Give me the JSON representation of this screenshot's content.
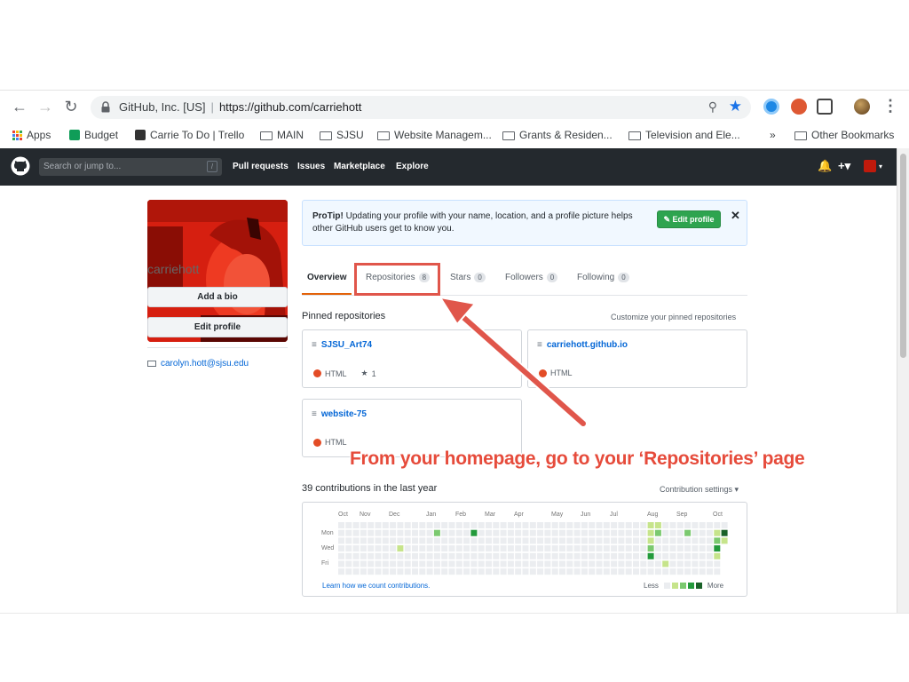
{
  "browser": {
    "site_identity": "GitHub, Inc. [US]",
    "url": "https://github.com/carriehott",
    "bookmarks": [
      "Apps",
      "Budget",
      "Carrie To Do | Trello",
      "MAIN",
      "SJSU",
      "Website Managem...",
      "Grants & Residen...",
      "Television and Ele..."
    ],
    "overflow": "»",
    "other_bookmarks": "Other Bookmarks"
  },
  "github_header": {
    "search_placeholder": "Search or jump to...",
    "search_shortcut": "/",
    "nav": [
      "Pull requests",
      "Issues",
      "Marketplace",
      "Explore"
    ],
    "add_label": "+▾"
  },
  "profile": {
    "username": "carriehott",
    "add_bio": "Add a bio",
    "edit_profile": "Edit profile",
    "email": "carolyn.hott@sjsu.edu"
  },
  "protip": {
    "label": "ProTip!",
    "text": " Updating your profile with your name, location, and a profile picture helps other GitHub users get to know you.",
    "button": "✎ Edit profile",
    "close": "✕"
  },
  "tabs": [
    {
      "label": "Overview",
      "count": ""
    },
    {
      "label": "Repositories",
      "count": "8"
    },
    {
      "label": "Stars",
      "count": "0"
    },
    {
      "label": "Followers",
      "count": "0"
    },
    {
      "label": "Following",
      "count": "0"
    }
  ],
  "pinned": {
    "title": "Pinned repositories",
    "customize": "Customize your pinned repositories",
    "repos": [
      {
        "name": "SJSU_Art74",
        "language": "HTML",
        "stars": "1"
      },
      {
        "name": "carriehott.github.io",
        "language": "HTML",
        "stars": ""
      },
      {
        "name": "website-75",
        "language": "HTML",
        "stars": ""
      }
    ]
  },
  "contributions": {
    "title": "39 contributions in the last year",
    "settings": "Contribution settings ▾",
    "months": [
      "Oct",
      "Nov",
      "Dec",
      "Jan",
      "Feb",
      "Mar",
      "Apr",
      "May",
      "Jun",
      "Jul",
      "Aug",
      "Sep",
      "Oct"
    ],
    "days": [
      "Mon",
      "Wed",
      "Fri"
    ],
    "learn_link": "Learn how we count contributions.",
    "less": "Less",
    "more": "More",
    "levels": [
      "#ebedf0",
      "#c6e48b",
      "#7bc96f",
      "#239a3b",
      "#196127"
    ],
    "active_cells": [
      {
        "week": 13,
        "day": 1,
        "level": 2
      },
      {
        "week": 18,
        "day": 1,
        "level": 3
      },
      {
        "week": 8,
        "day": 3,
        "level": 1
      },
      {
        "week": 42,
        "day": 0,
        "level": 1
      },
      {
        "week": 43,
        "day": 0,
        "level": 1
      },
      {
        "week": 42,
        "day": 1,
        "level": 1
      },
      {
        "week": 43,
        "day": 1,
        "level": 2
      },
      {
        "week": 42,
        "day": 2,
        "level": 1
      },
      {
        "week": 42,
        "day": 3,
        "level": 2
      },
      {
        "week": 42,
        "day": 4,
        "level": 3
      },
      {
        "week": 44,
        "day": 5,
        "level": 1
      },
      {
        "week": 47,
        "day": 1,
        "level": 2
      },
      {
        "week": 51,
        "day": 1,
        "level": 1
      },
      {
        "week": 51,
        "day": 2,
        "level": 2
      },
      {
        "week": 51,
        "day": 3,
        "level": 3
      },
      {
        "week": 51,
        "day": 4,
        "level": 1
      },
      {
        "week": 52,
        "day": 1,
        "level": 4
      },
      {
        "week": 52,
        "day": 2,
        "level": 1
      }
    ]
  },
  "annotation": "From your homepage, go to your ‘Repositories’ page",
  "colors": {
    "annotation": "#e64b3b",
    "gh_header": "#24292e",
    "link": "#0366d6",
    "tab_accent": "#e36209",
    "html_language": "#e34c26"
  }
}
